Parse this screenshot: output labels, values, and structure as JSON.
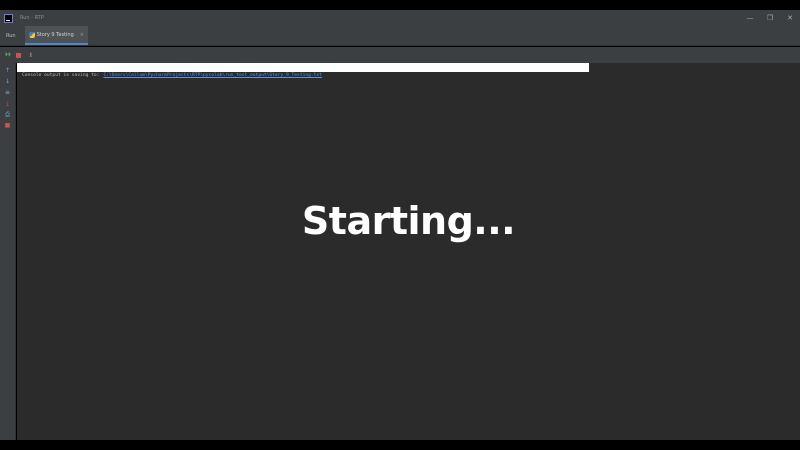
{
  "window": {
    "title": "Run - RTP",
    "controls": {
      "minimize": "—",
      "maximize": "❐",
      "close": "✕"
    }
  },
  "tool_window": {
    "title": "Run",
    "tab": {
      "label": "Story 9 Testing",
      "close": "×",
      "icon": "python-icon"
    }
  },
  "toolbar": {
    "rerun_icon": "⏵⏵",
    "stop_icon": "stop-icon",
    "cursor": "I"
  },
  "side_toolbar": {
    "icons": [
      "up-arrow-icon",
      "down-arrow-icon",
      "soft-wrap-icon",
      "scroll-to-end-icon",
      "print-icon",
      "trash-icon"
    ]
  },
  "console": {
    "message": "Console output is saving to:",
    "link": "C:\\Users\\Callum\\PycharmProjects\\RTP\\pycolab\\run_test_output\\Story_9_Testing.txt",
    "progress": 1.0
  },
  "overlay": {
    "text": "Starting..."
  },
  "colors": {
    "background": "#2b2b2b",
    "chrome": "#3c3f41",
    "accent": "#4a88c7",
    "link": "#5394ec",
    "stop": "#c75450"
  }
}
